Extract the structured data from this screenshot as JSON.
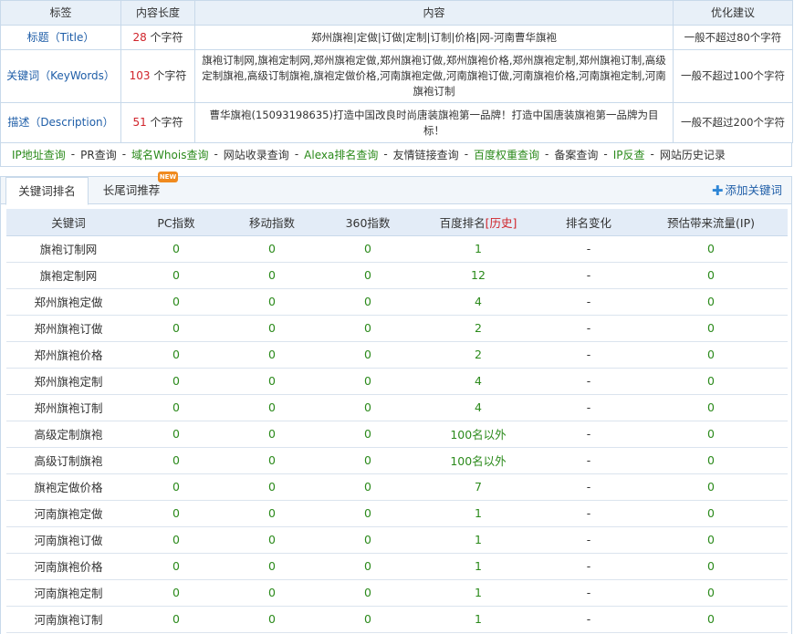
{
  "info_table": {
    "headers": [
      "标签",
      "内容长度",
      "内容",
      "优化建议"
    ],
    "rows": [
      {
        "label": "标题（Title）",
        "length": "28",
        "unit": "个字符",
        "content": "郑州旗袍|定做|订做|定制|订制|价格|网-河南曹华旗袍",
        "suggestion": "一般不超过80个字符"
      },
      {
        "label": "关键词（KeyWords）",
        "length": "103",
        "unit": "个字符",
        "content": "旗袍订制网,旗袍定制网,郑州旗袍定做,郑州旗袍订做,郑州旗袍价格,郑州旗袍定制,郑州旗袍订制,高级定制旗袍,高级订制旗袍,旗袍定做价格,河南旗袍定做,河南旗袍订做,河南旗袍价格,河南旗袍定制,河南旗袍订制",
        "suggestion": "一般不超过100个字符"
      },
      {
        "label": "描述（Description）",
        "length": "51",
        "unit": "个字符",
        "content": "曹华旗袍(15093198635)打造中国改良时尚唐装旗袍第一品牌！打造中国唐装旗袍第一品牌为目标！",
        "suggestion": "一般不超过200个字符"
      }
    ]
  },
  "tools": [
    {
      "label": "IP地址查询",
      "color": "green"
    },
    {
      "label": "PR查询",
      "color": "dark"
    },
    {
      "label": "域名Whois查询",
      "color": "green"
    },
    {
      "label": "网站收录查询",
      "color": "dark"
    },
    {
      "label": "Alexa排名查询",
      "color": "green"
    },
    {
      "label": "友情链接查询",
      "color": "dark"
    },
    {
      "label": "百度权重查询",
      "color": "green"
    },
    {
      "label": "备案查询",
      "color": "dark"
    },
    {
      "label": "IP反查",
      "color": "green"
    },
    {
      "label": "网站历史记录",
      "color": "dark"
    }
  ],
  "tools_separator": "-",
  "tabs": {
    "active": "关键词排名",
    "second": "长尾词推荐",
    "badge": "NEW",
    "add_keyword": "添加关键词"
  },
  "keyword_table": {
    "headers": [
      "关键词",
      "PC指数",
      "移动指数",
      "360指数",
      "百度排名",
      "排名变化",
      "预估带来流量(IP)"
    ],
    "history_label": "[历史]",
    "rows": [
      {
        "kw": "旗袍订制网",
        "pc": "0",
        "mobile": "0",
        "s360": "0",
        "rank": "1",
        "change": "-",
        "traffic": "0"
      },
      {
        "kw": "旗袍定制网",
        "pc": "0",
        "mobile": "0",
        "s360": "0",
        "rank": "12",
        "change": "-",
        "traffic": "0"
      },
      {
        "kw": "郑州旗袍定做",
        "pc": "0",
        "mobile": "0",
        "s360": "0",
        "rank": "4",
        "change": "-",
        "traffic": "0"
      },
      {
        "kw": "郑州旗袍订做",
        "pc": "0",
        "mobile": "0",
        "s360": "0",
        "rank": "2",
        "change": "-",
        "traffic": "0"
      },
      {
        "kw": "郑州旗袍价格",
        "pc": "0",
        "mobile": "0",
        "s360": "0",
        "rank": "2",
        "change": "-",
        "traffic": "0"
      },
      {
        "kw": "郑州旗袍定制",
        "pc": "0",
        "mobile": "0",
        "s360": "0",
        "rank": "4",
        "change": "-",
        "traffic": "0"
      },
      {
        "kw": "郑州旗袍订制",
        "pc": "0",
        "mobile": "0",
        "s360": "0",
        "rank": "4",
        "change": "-",
        "traffic": "0"
      },
      {
        "kw": "高级定制旗袍",
        "pc": "0",
        "mobile": "0",
        "s360": "0",
        "rank": "100名以外",
        "change": "-",
        "traffic": "0"
      },
      {
        "kw": "高级订制旗袍",
        "pc": "0",
        "mobile": "0",
        "s360": "0",
        "rank": "100名以外",
        "change": "-",
        "traffic": "0"
      },
      {
        "kw": "旗袍定做价格",
        "pc": "0",
        "mobile": "0",
        "s360": "0",
        "rank": "7",
        "change": "-",
        "traffic": "0"
      },
      {
        "kw": "河南旗袍定做",
        "pc": "0",
        "mobile": "0",
        "s360": "0",
        "rank": "1",
        "change": "-",
        "traffic": "0"
      },
      {
        "kw": "河南旗袍订做",
        "pc": "0",
        "mobile": "0",
        "s360": "0",
        "rank": "1",
        "change": "-",
        "traffic": "0"
      },
      {
        "kw": "河南旗袍价格",
        "pc": "0",
        "mobile": "0",
        "s360": "0",
        "rank": "1",
        "change": "-",
        "traffic": "0"
      },
      {
        "kw": "河南旗袍定制",
        "pc": "0",
        "mobile": "0",
        "s360": "0",
        "rank": "1",
        "change": "-",
        "traffic": "0"
      },
      {
        "kw": "河南旗袍订制",
        "pc": "0",
        "mobile": "0",
        "s360": "0",
        "rank": "1",
        "change": "-",
        "traffic": "0"
      }
    ]
  },
  "colors": {
    "link_blue": "#1f5ea8",
    "green": "#2b8a1b",
    "red": "#d0232a",
    "border": "#c8d9ea",
    "header_bg": "#e3ecf7"
  }
}
